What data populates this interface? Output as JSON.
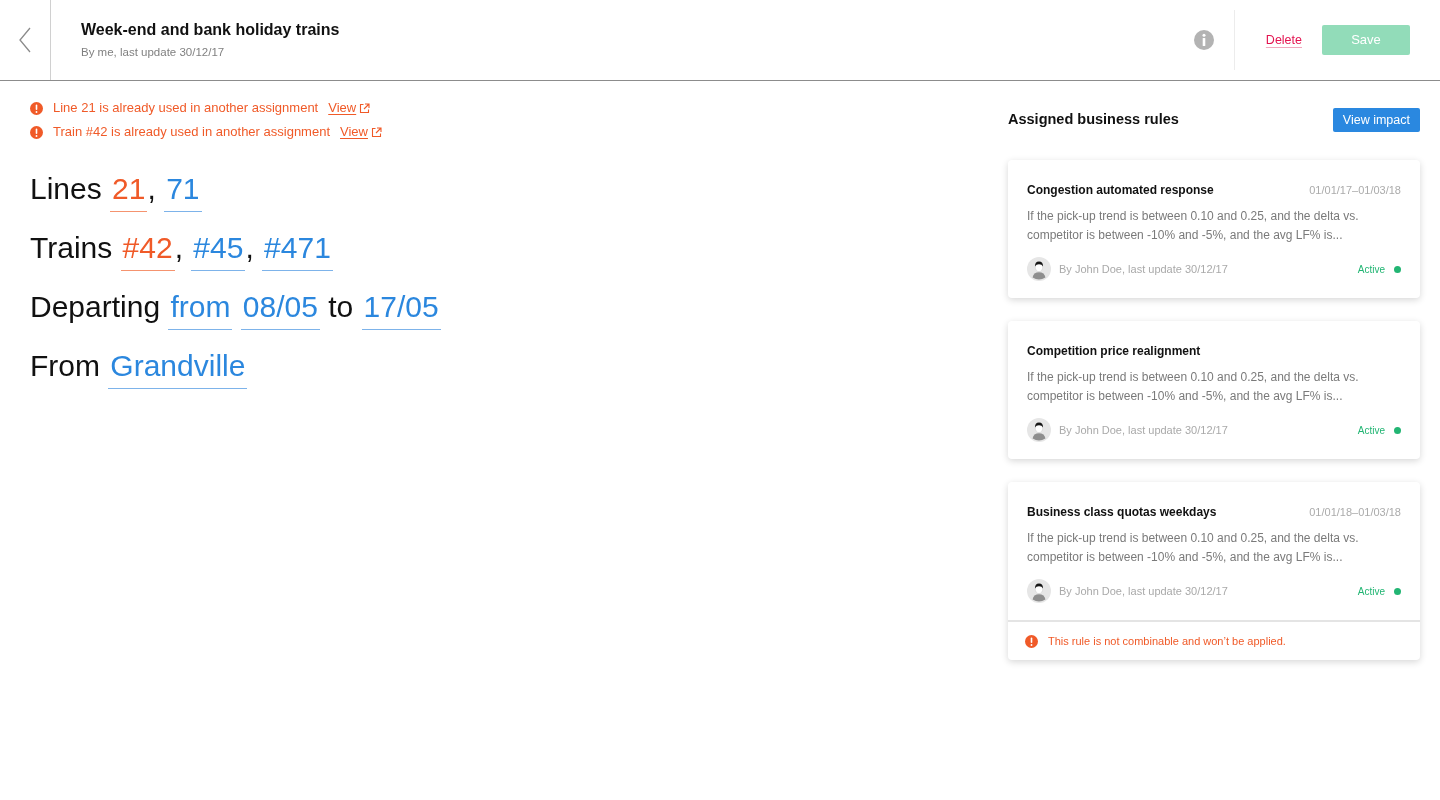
{
  "header": {
    "title": "Week-end and bank holiday trains",
    "subtitle": "By me, last update 30/12/17",
    "delete_label": "Delete",
    "save": {
      "label": "Save",
      "disabled": true
    }
  },
  "warnings": [
    {
      "text": "Line 21 is already used in another assignment",
      "link": "View"
    },
    {
      "text": "Train #42 is already used in another assignment",
      "link": "View"
    }
  ],
  "criteria": [
    {
      "parts": [
        {
          "kind": "word",
          "text": "Lines"
        },
        {
          "kind": "value",
          "text": "21",
          "conflict": true
        },
        {
          "kind": "punct",
          "text": ","
        },
        {
          "kind": "value",
          "text": "71",
          "conflict": false
        }
      ]
    },
    {
      "parts": [
        {
          "kind": "word",
          "text": "Trains"
        },
        {
          "kind": "value",
          "text": "#42",
          "conflict": true
        },
        {
          "kind": "punct",
          "text": ","
        },
        {
          "kind": "value",
          "text": "#45",
          "conflict": false
        },
        {
          "kind": "punct",
          "text": ","
        },
        {
          "kind": "value",
          "text": "#471",
          "conflict": false
        }
      ]
    },
    {
      "parts": [
        {
          "kind": "word",
          "text": "Departing"
        },
        {
          "kind": "value",
          "text": "from",
          "conflict": false
        },
        {
          "kind": "value",
          "text": "08/05",
          "conflict": false
        },
        {
          "kind": "word",
          "text": "to"
        },
        {
          "kind": "value",
          "text": "17/05",
          "conflict": false
        }
      ]
    },
    {
      "parts": [
        {
          "kind": "word",
          "text": "From"
        },
        {
          "kind": "value",
          "text": "Grandville",
          "conflict": false
        }
      ]
    }
  ],
  "rules_panel": {
    "title": "Assigned business rules",
    "action": "View impact",
    "rules": [
      {
        "title": "Congestion automated response",
        "dates": "01/01/17–01/03/18",
        "description": "If the pick-up trend is between 0.10 and 0.25, and the delta vs. competitor is between -10% and -5%, and the avg LF% is...",
        "author": "By John Doe, last update 30/12/17",
        "status": "Active",
        "active": true
      },
      {
        "title": "Competition price realignment",
        "description": "If the pick-up trend is between 0.10 and 0.25, and the delta vs. competitor is between -10% and -5%, and the avg LF% is...",
        "author": "By John Doe, last update 30/12/17",
        "status": "Active",
        "active": true
      },
      {
        "title": "Business class quotas weekdays",
        "dates": "01/01/18–01/03/18",
        "description": "If the pick-up trend is between 0.10 and 0.25, and the delta vs. competitor is between -10% and -5%, and the avg LF% is...",
        "author": "By John Doe, last update 30/12/17",
        "status": "Active",
        "active": true,
        "warning": "This rule is not combinable and won’t be applied."
      }
    ]
  }
}
